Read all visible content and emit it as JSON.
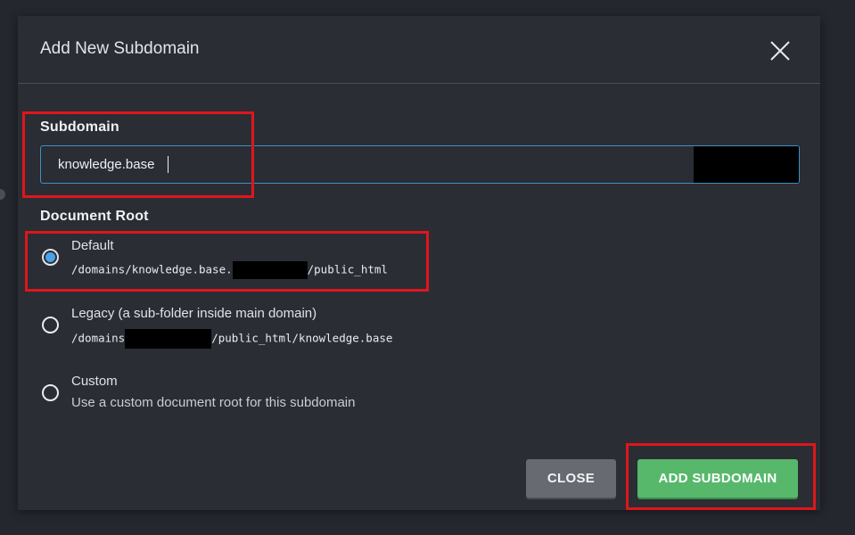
{
  "dialog": {
    "title": "Add New Subdomain",
    "close_icon": "close-icon"
  },
  "subdomain": {
    "label": "Subdomain",
    "value": "knowledge.base"
  },
  "document_root": {
    "label": "Document Root",
    "options": [
      {
        "title": "Default",
        "path_prefix": "/domains/knowledge.base.",
        "path_suffix": "/public_html",
        "checked": true
      },
      {
        "title": "Legacy (a sub-folder inside main domain)",
        "path_prefix": "/domains",
        "path_suffix": "/public_html/knowledge.base",
        "checked": false
      },
      {
        "title": "Custom",
        "description": "Use a custom document root for this subdomain",
        "checked": false
      }
    ]
  },
  "buttons": {
    "close_label": "CLOSE",
    "add_label": "ADD SUBDOMAIN"
  },
  "colors": {
    "highlight": "#e0151c",
    "primary": "#57b86b",
    "focus": "#3f8fc2",
    "radio_selected": "#4aa3e8"
  }
}
